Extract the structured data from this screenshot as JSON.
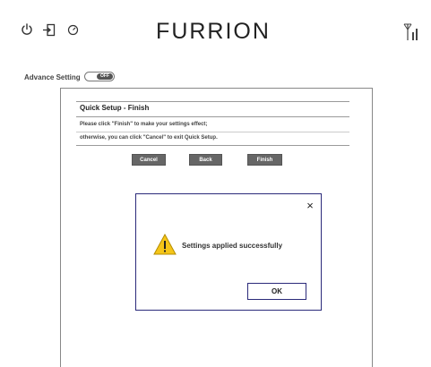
{
  "header": {
    "brand": "FURRION",
    "icons": [
      "power-icon",
      "logout-icon",
      "clock-icon",
      "signal-icon"
    ]
  },
  "advance_setting": {
    "label": "Advance Setting",
    "toggle_state": "OFF"
  },
  "quick_setup": {
    "title": "Quick Setup - Finish",
    "line1": "Please click \"Finish\" to make your settings effect;",
    "line2": "otherwise, you can click \"Cancel\" to exit Quick Setup.",
    "buttons": {
      "cancel": "Cancel",
      "back": "Back",
      "finish": "Finish"
    }
  },
  "dialog": {
    "close": "×",
    "message": "Settings applied successfully",
    "ok": "OK",
    "icon": "warning-icon"
  },
  "colors": {
    "dialog_border": "#2b2a7a",
    "button_bg": "#666666",
    "warning_fill": "#f5c518"
  }
}
